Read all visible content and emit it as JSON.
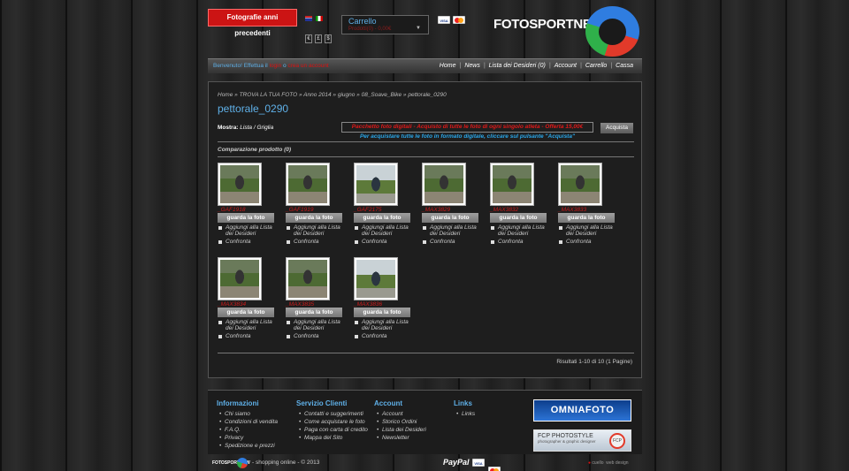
{
  "header": {
    "prev_years_button": "Fotografie anni precedenti",
    "currencies": [
      "€",
      "£",
      "$"
    ],
    "cart": {
      "title": "Carrello",
      "subtitle": "Prodotti(0) - 0,00€"
    },
    "logo": "FOTOSPORTNEW"
  },
  "navbar": {
    "welcome_prefix": "Benvenuto! Effettua il",
    "login": "login",
    "welcome_or": "o",
    "register": "crea un account",
    "links": [
      "Home",
      "News",
      "Lista dei Desideri (0)",
      "Account",
      "Carrello",
      "Cassa"
    ]
  },
  "content": {
    "breadcrumb": "Home » TROVA LA TUA FOTO » Anno 2014 » giugno » 08_Soave_Bike » pettorale_0290",
    "title": "pettorale_0290",
    "show_label": "Mostra:",
    "show_options": "Lista / Griglia",
    "package_banner": "Pacchetto foto digitali - Acquisto di tutte le foto di ogni singolo atleta - Offerta 15,00€",
    "package_info": "Per acquistare tutte le foto in formato digitale, cliccare sul pulsante \"Acquista\"",
    "buy_button": "Acquista",
    "compare": "Comparazione prodotto (0)",
    "view_button": "guarda la foto",
    "wishlist_label": "Aggiungi alla Lista dei Desideri",
    "compare_label": "Confronta",
    "products": [
      {
        "name": "_GAF1918"
      },
      {
        "name": "_GAF1919"
      },
      {
        "name": "_GAF2175"
      },
      {
        "name": "_MAX3829"
      },
      {
        "name": "_MAX3832"
      },
      {
        "name": "_MAX3833"
      },
      {
        "name": "_MAX3834"
      },
      {
        "name": "_MAX3835"
      },
      {
        "name": "_MAX3836"
      }
    ],
    "results": "Risultati 1-10 di 10 (1 Pagine)"
  },
  "footer": {
    "columns": [
      {
        "title": "Informazioni",
        "items": [
          "Chi siamo",
          "Condizioni di vendita",
          "F.A.Q.",
          "Privacy",
          "Spedizione e prezzi"
        ]
      },
      {
        "title": "Servizio Clienti",
        "items": [
          "Contatti e suggerimenti",
          "Come acquistare le foto",
          "Paga con carta di credito",
          "Mappa del Sito"
        ]
      },
      {
        "title": "Account",
        "items": [
          "Account",
          "Storico Ordini",
          "Lista dei Desideri",
          "Newsletter"
        ]
      },
      {
        "title": "Links",
        "items": [
          "Links"
        ]
      }
    ],
    "omniafoto": "OMNIAFOTO",
    "fcp_title": "FCP PHOTOSTYLE",
    "fcp_sub": "photographer & graphic designer",
    "fcp_badge": "FCP",
    "bottom_logo": "FOTOSPORTNEW",
    "copyright": "- shopping online - © 2013",
    "paypal": "PayPal",
    "credits_a": "cuello",
    "credits_b": "web design"
  }
}
